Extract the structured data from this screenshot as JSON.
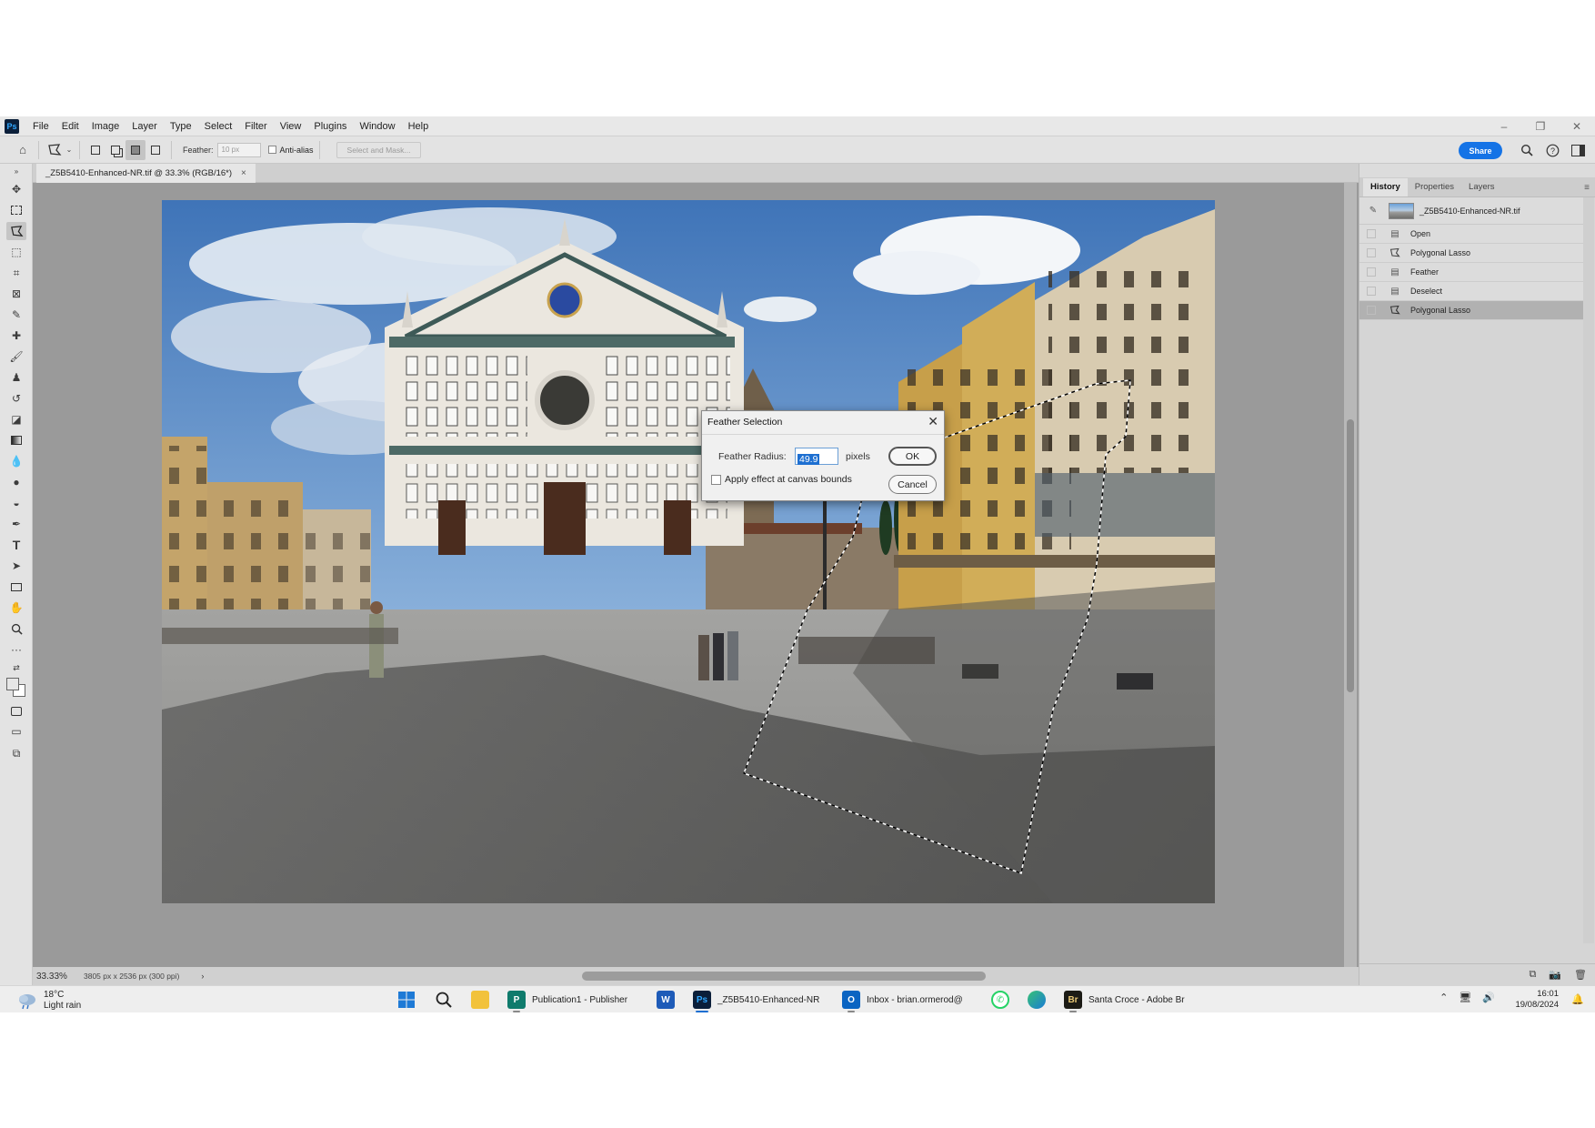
{
  "menubar": {
    "logo": "Ps",
    "items": [
      "File",
      "Edit",
      "Image",
      "Layer",
      "Type",
      "Select",
      "Filter",
      "View",
      "Plugins",
      "Window",
      "Help"
    ]
  },
  "options": {
    "feather_label": "Feather:",
    "feather_value": "10 px",
    "antialias_label": "Anti-alias",
    "select_mask_label": "Select and Mask...",
    "share_label": "Share"
  },
  "document": {
    "tab_title": "_Z5B5410-Enhanced-NR.tif @ 33.3% (RGB/16*)",
    "zoom": "33.33%",
    "dimensions": "3805 px x 2536 px (300 ppi)"
  },
  "panel": {
    "tabs": [
      "History",
      "Properties",
      "Layers"
    ],
    "snapshot_label": "_Z5B5410-Enhanced-NR.tif",
    "history": [
      {
        "label": "Open",
        "icon": "document-icon"
      },
      {
        "label": "Polygonal Lasso",
        "icon": "polygonal-lasso-icon"
      },
      {
        "label": "Feather",
        "icon": "document-icon"
      },
      {
        "label": "Deselect",
        "icon": "document-icon"
      },
      {
        "label": "Polygonal Lasso",
        "icon": "polygonal-lasso-icon",
        "selected": true
      }
    ]
  },
  "dialog": {
    "title": "Feather Selection",
    "radius_label": "Feather Radius:",
    "radius_value": "49.9",
    "radius_unit": "pixels",
    "canvas_bounds_label": "Apply effect at canvas bounds",
    "ok_label": "OK",
    "cancel_label": "Cancel"
  },
  "taskbar": {
    "temperature": "18°C",
    "weather": "Light rain",
    "apps": [
      {
        "label": "Publication1 - Publisher"
      },
      {
        "label": "_Z5B5410-Enhanced-NR"
      },
      {
        "label": "Inbox - brian.ormerod@"
      },
      {
        "label": "Santa Croce - Adobe Br"
      }
    ],
    "time": "16:01",
    "date": "19/08/2024"
  },
  "colors": {
    "accent": "#1473e6",
    "selection_highlight": "#1d6fd1",
    "sky": "#4a7fc0",
    "facade": "#e8e4dc",
    "ochre_buildings": "#c9a24f"
  }
}
